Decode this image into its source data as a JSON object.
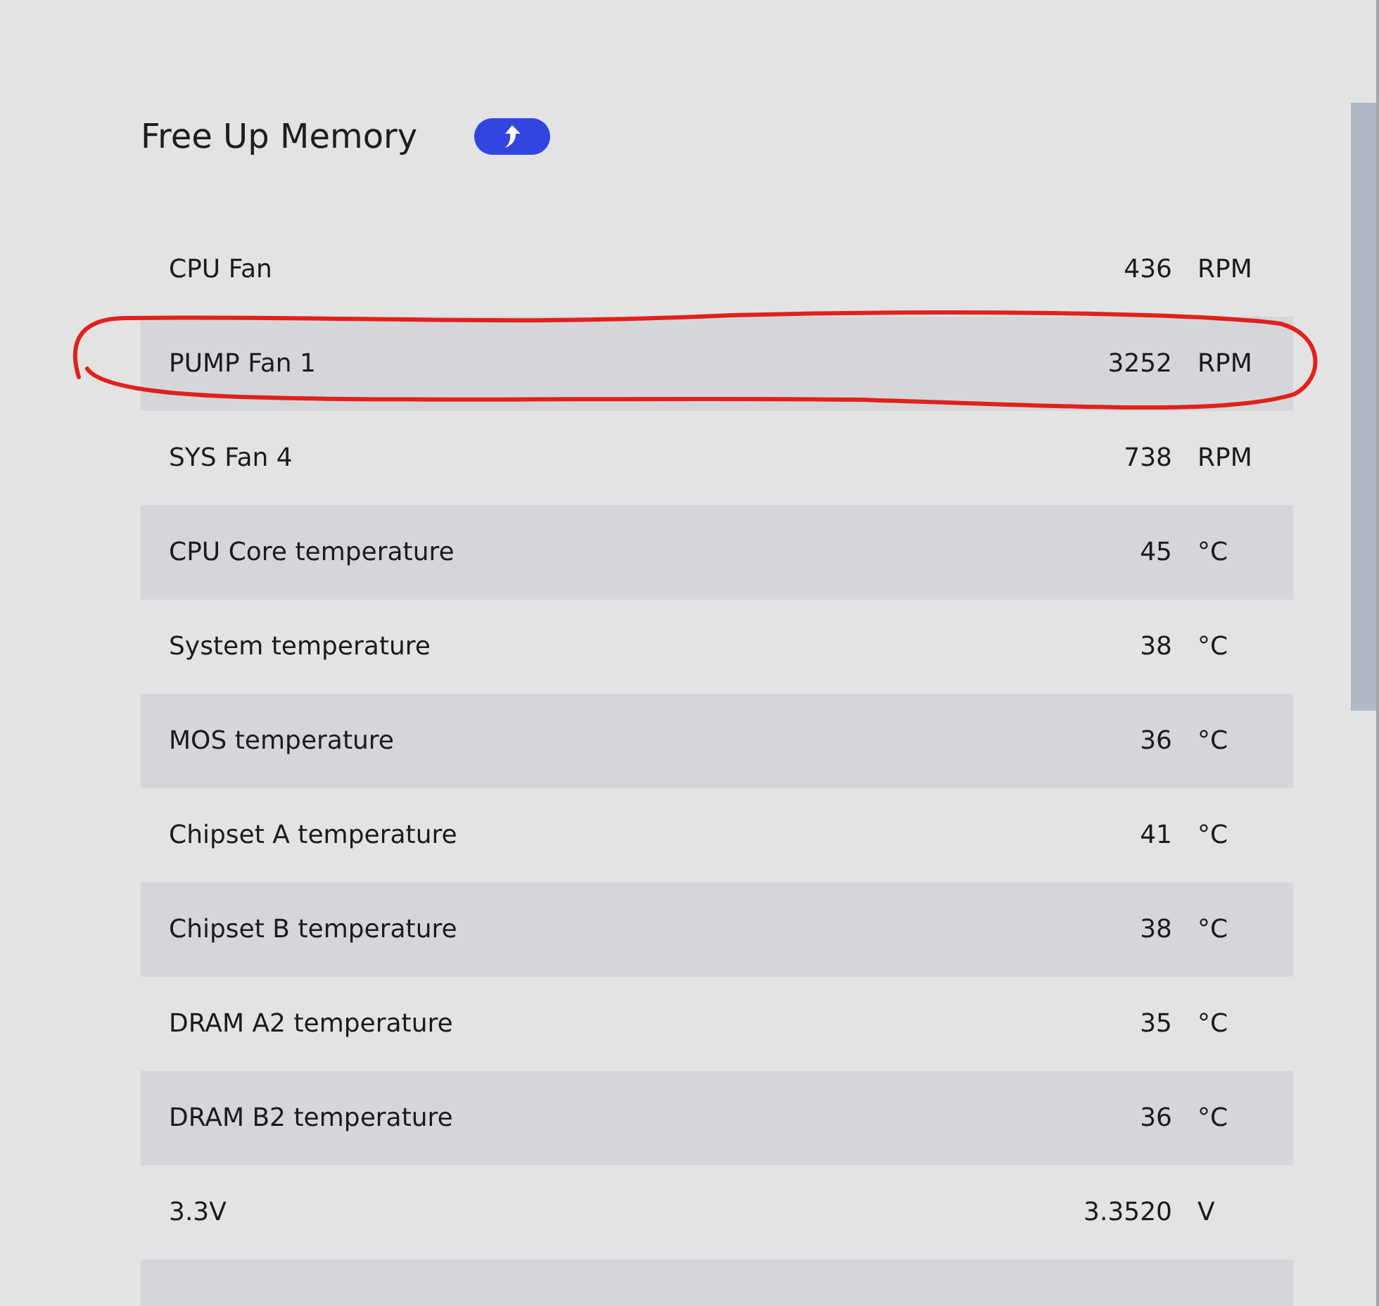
{
  "header": {
    "title": "Free Up Memory"
  },
  "sensors": [
    {
      "name": "CPU Fan",
      "value": "436",
      "unit": "RPM",
      "circled": false
    },
    {
      "name": "PUMP Fan 1",
      "value": "3252",
      "unit": "RPM",
      "circled": true
    },
    {
      "name": "SYS Fan 4",
      "value": "738",
      "unit": "RPM",
      "circled": false
    },
    {
      "name": "CPU Core temperature",
      "value": "45",
      "unit": "°C",
      "circled": false
    },
    {
      "name": "System temperature",
      "value": "38",
      "unit": "°C",
      "circled": false
    },
    {
      "name": "MOS temperature",
      "value": "36",
      "unit": "°C",
      "circled": false
    },
    {
      "name": "Chipset A temperature",
      "value": "41",
      "unit": "°C",
      "circled": false
    },
    {
      "name": "Chipset B temperature",
      "value": "38",
      "unit": "°C",
      "circled": false
    },
    {
      "name": "DRAM A2 temperature",
      "value": "35",
      "unit": "°C",
      "circled": false
    },
    {
      "name": "DRAM B2 temperature",
      "value": "36",
      "unit": "°C",
      "circled": false
    },
    {
      "name": "3.3V",
      "value": "3.3520",
      "unit": "V",
      "circled": false
    }
  ]
}
